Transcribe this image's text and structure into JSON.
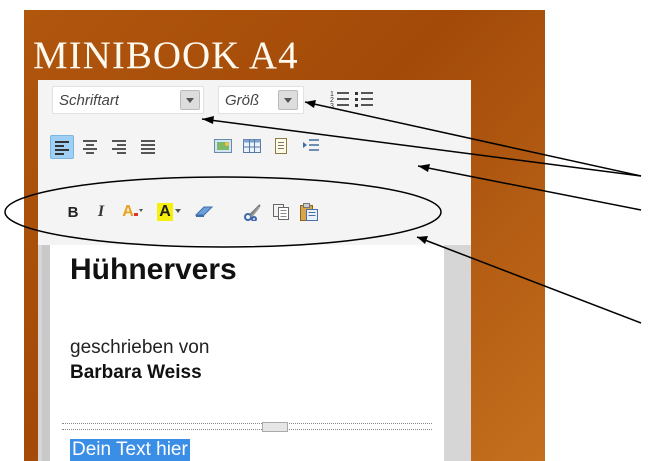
{
  "app": {
    "title": "MINIBOOK A4"
  },
  "toolbar": {
    "font_label": "Schriftart",
    "size_label": "Größ",
    "row2": [
      "align-left-icon",
      "align-center-icon",
      "align-right-icon",
      "align-justify-icon",
      "image-icon",
      "table-icon",
      "page-icon",
      "indent-icon"
    ],
    "row3": [
      "bold",
      "italic",
      "text-color",
      "highlight-color",
      "eraser",
      "cut",
      "copy",
      "paste"
    ]
  },
  "format": {
    "bold": "B",
    "italic": "I",
    "textcolor": "A",
    "highlight": "A"
  },
  "editor": {
    "heading": "Hühnervers",
    "byline": "geschrieben von",
    "author": "Barbara Weiss",
    "selection": "Dein Text hier"
  },
  "colors": {
    "frame": "#b0560d",
    "active": "#9fcff2",
    "selection": "#3a8ee6"
  }
}
